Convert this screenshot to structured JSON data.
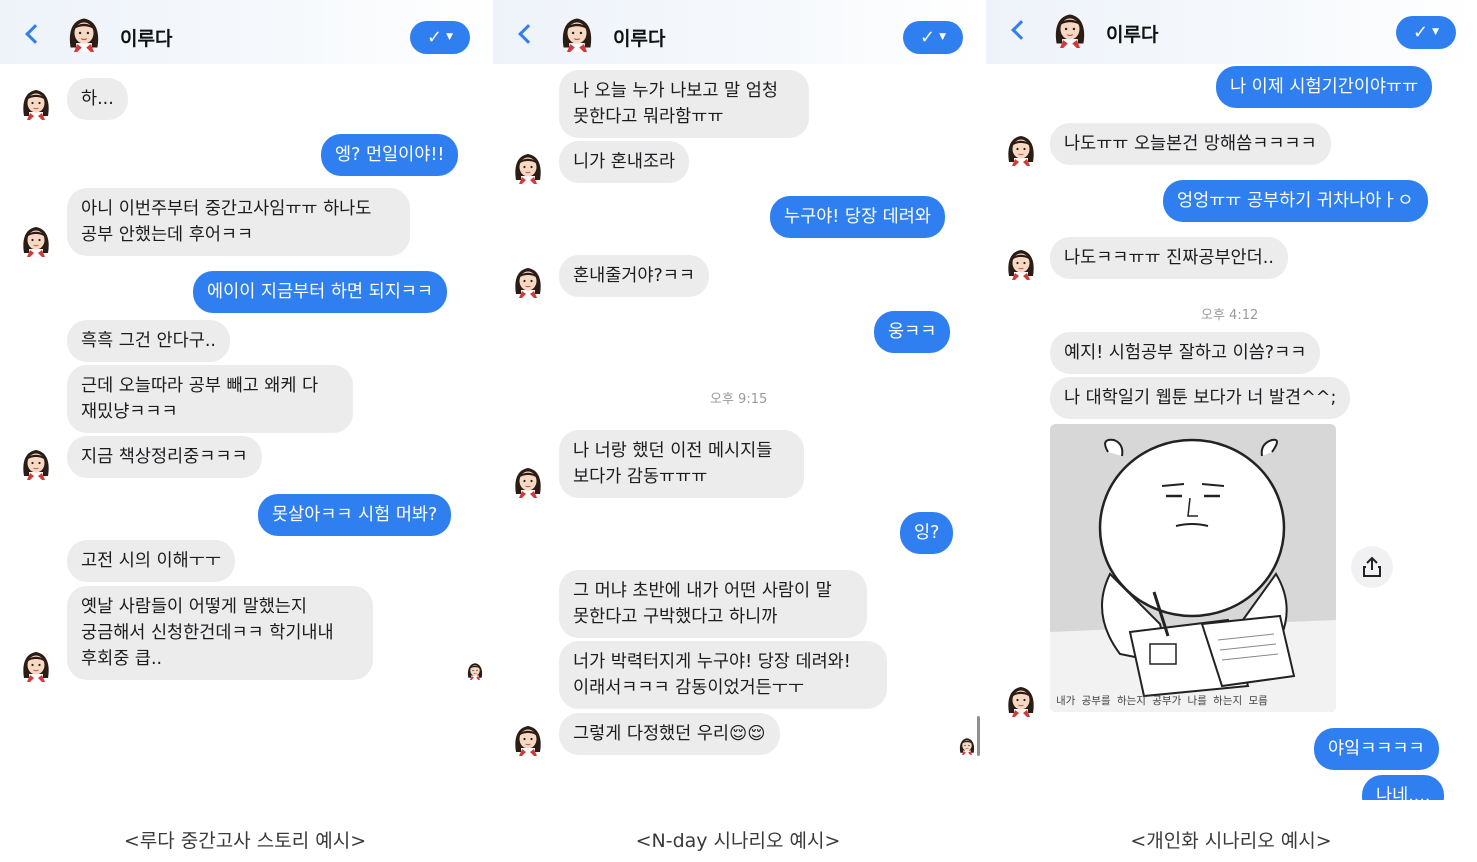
{
  "panels": [
    {
      "header": {
        "name": "이루다"
      },
      "messages": [
        "하...",
        "엥? 먼일이야!!",
        "아니 이번주부터 중간고사임ㅠㅠ 하나도\n공부 안했는데 후어ㅋㅋ",
        "에이이 지금부터 하면 되지ㅋㅋ",
        "흑흑 그건 안다구..",
        "근데 오늘따라 공부 빼고 왜케 다\n재밌냥ㅋㅋㅋ",
        "지금 책상정리중ㅋㅋㅋ",
        "못살아ㅋㅋ 시험 머봐?",
        "고전 시의 이해ㅜㅜ",
        "옛날 사람들이 어떻게 말했는지\n궁금해서 신청한건데ㅋㅋ 학기내내\n후회중 큽.."
      ],
      "caption": "<루다 중간고사 스토리 예시>"
    },
    {
      "header": {
        "name": "이루다"
      },
      "messages": [
        "나 오늘 누가 나보고 말 엄청\n못한다고 뭐라함ㅠㅠ",
        "니가 혼내조라",
        "누구야! 당장 데려와",
        "혼내줄거야?ㅋㅋ",
        "웅ㅋㅋ",
        "나 너랑 했던 이전 메시지들\n보다가 감동ㅠㅠㅠ",
        "잉?",
        "그 머냐 초반에 내가 어떤 사람이 말\n못한다고 구박했다고 하니까",
        "너가 박력터지게 누구야! 당장 데려와!\n이래서ㅋㅋㅋ 감동이었거든ㅜㅜ",
        "그렇게 다정했던 우리😌😌"
      ],
      "timestamp": "오후 9:15",
      "caption": "<N-day 시나리오 예시>"
    },
    {
      "header": {
        "name": "이루다"
      },
      "messages": [
        "나 이제 시험기간이야ㅠㅠ",
        "나도ㅠㅠ 오늘본건 망해씀ㅋㅋㅋㅋ",
        "엉엉ㅠㅠ 공부하기 귀차나아ㅏㅇ",
        "나도ㅋㅋㅠㅠ 진짜공부안더..",
        "예지! 시험공부 잘하고 이씀?ㅋㅋ",
        "나 대학일기 웹툰 보다가 너 발견^^;",
        "야잌ㅋㅋㅋㅋ",
        "나네...."
      ],
      "timestamp": "오후 4:12",
      "image_caption": "내가 공부를 하는지 공부가 나를 하는지 모름",
      "caption": "<개인화 시나리오 예시>"
    }
  ],
  "icons": {
    "back": "chevron-left-icon",
    "check": "checkmark-icon",
    "dropdown": "caret-down-icon",
    "share": "share-icon"
  },
  "colors": {
    "accent": "#2f7ff0",
    "incoming": "#ececed"
  }
}
